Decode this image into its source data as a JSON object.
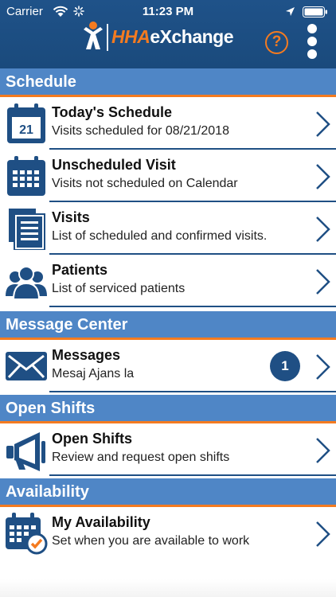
{
  "status_bar": {
    "carrier": "Carrier",
    "time": "11:23 PM"
  },
  "header": {
    "logo_hha": "HHA",
    "logo_exchange": "eXchange",
    "help_label": "?"
  },
  "sections": {
    "schedule": {
      "title": "Schedule",
      "todays_schedule": {
        "title": "Today's Schedule",
        "subtitle": "Visits scheduled for 08/21/2018",
        "calendar_day": "21"
      },
      "unscheduled_visit": {
        "title": "Unscheduled Visit",
        "subtitle": "Visits not scheduled on Calendar"
      },
      "visits": {
        "title": "Visits",
        "subtitle": "List of scheduled and confirmed visits."
      },
      "patients": {
        "title": "Patients",
        "subtitle": "List of serviced patients"
      }
    },
    "message_center": {
      "title": "Message Center",
      "messages": {
        "title": "Messages",
        "subtitle": "Mesaj Ajans la",
        "badge": "1"
      }
    },
    "open_shifts": {
      "title": "Open Shifts",
      "open_shifts": {
        "title": "Open Shifts",
        "subtitle": "Review and request open shifts"
      }
    },
    "availability": {
      "title": "Availability",
      "my_availability": {
        "title": "My Availability",
        "subtitle": "Set when you are available to work"
      }
    }
  },
  "colors": {
    "navy": "#1f4f84",
    "header_blue": "#4f86c6",
    "accent_orange": "#f47b20"
  }
}
